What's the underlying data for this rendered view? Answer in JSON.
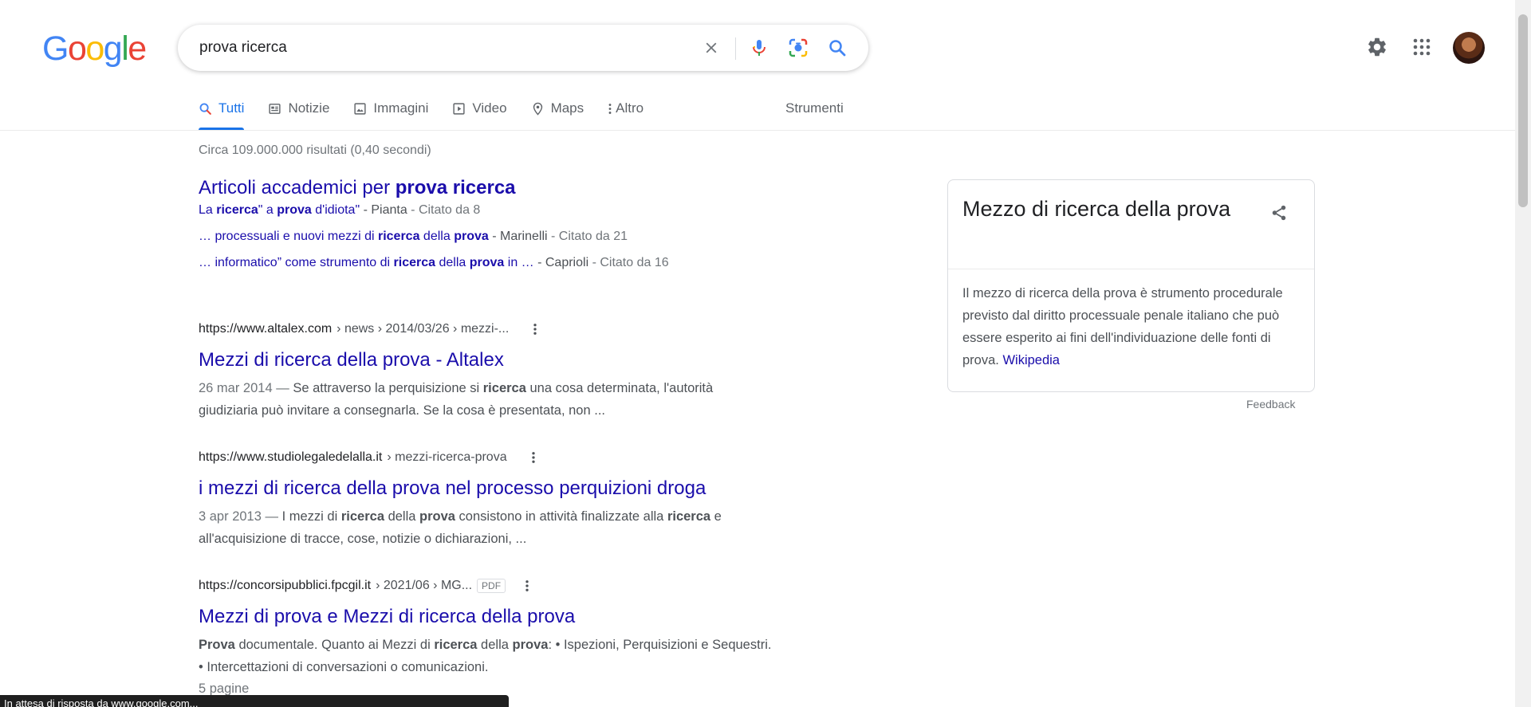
{
  "logo": {
    "letters": [
      "G",
      "o",
      "o",
      "g",
      "l",
      "e"
    ],
    "colors": [
      "#4285F4",
      "#EA4335",
      "#FBBC05",
      "#4285F4",
      "#34A853",
      "#EA4335"
    ]
  },
  "search": {
    "query": "prova ricerca"
  },
  "tabs": [
    {
      "label": "Tutti",
      "icon": "search-icon",
      "active": true
    },
    {
      "label": "Notizie",
      "icon": "newspaper-icon"
    },
    {
      "label": "Immagini",
      "icon": "image-icon"
    },
    {
      "label": "Video",
      "icon": "play-icon"
    },
    {
      "label": "Maps",
      "icon": "map-pin-icon"
    },
    {
      "label": "Altro",
      "icon": "more-vert-icon"
    }
  ],
  "tools_label": "Strumenti",
  "stats": "Circa 109.000.000 risultati (0,40 secondi)",
  "scholar": {
    "title_prefix": "Articoli accademici per ",
    "title_query": "prova ricerca",
    "lines": [
      {
        "pre": "La ",
        "b1": "ricerca",
        "mid1": "\" a ",
        "b2": "prova",
        "post": " d'idiota\"",
        "author": " - Pianta",
        "cited": " - Citato da 8"
      },
      {
        "pre": "… processuali e nuovi mezzi di ",
        "b1": "ricerca",
        "mid1": " della ",
        "b2": "prova",
        "post": "",
        "author": " - Marinelli",
        "cited": " - Citato da 21"
      },
      {
        "pre": "… informatico” come strumento di ",
        "b1": "ricerca",
        "mid1": " della ",
        "b2": "prova",
        "post": " in …",
        "author": " - Caprioli",
        "cited": " - Citato da 16"
      }
    ]
  },
  "results": [
    {
      "domain": "https://www.altalex.com",
      "path": "› news › 2014/03/26 › mezzi-...",
      "title": "Mezzi di ricerca della prova - Altalex",
      "date": "26 mar 2014 — ",
      "s1": "Se attraverso la perquisizione si ",
      "b1": "ricerca",
      "s2": " una cosa determinata, l'autorità giudiziaria può invitare a consegnarla. Se la cosa è presentata, non ..."
    },
    {
      "domain": "https://www.studiolegaledelalla.it",
      "path": "› mezzi-ricerca-prova",
      "title": "i mezzi di ricerca della prova nel processo perquizioni droga",
      "date": "3 apr 2013 — ",
      "s1": "I mezzi di ",
      "b1": "ricerca",
      "s2": " della ",
      "b2": "prova",
      "s3": " consistono in attività finalizzate alla ",
      "b3": "ricerca",
      "s4": " e all'acquisizione di tracce, cose, notizie o dichiarazioni, ..."
    },
    {
      "domain": "https://concorsipubblici.fpcgil.it",
      "path": "› 2021/06 › MG...",
      "badge": "PDF",
      "title": "Mezzi di prova e Mezzi di ricerca della prova",
      "b0": "Prova",
      "s1": " documentale. Quanto ai Mezzi di ",
      "b1": "ricerca",
      "s2": " della ",
      "b2": "prova",
      "s3": ": • Ispezioni, Perquisizioni e Sequestri. • Intercettazioni di conversazioni o comunicazioni.",
      "extra": "5 pagine"
    }
  ],
  "knowledge_panel": {
    "title": "Mezzo di ricerca della prova",
    "description": "Il mezzo di ricerca della prova è strumento procedurale previsto dal diritto processuale penale italiano che può essere esperito ai fini dell'individuazione delle fonti di prova. ",
    "source": "Wikipedia",
    "feedback": "Feedback"
  },
  "status_bar": "In attesa di risposta da www.google.com..."
}
